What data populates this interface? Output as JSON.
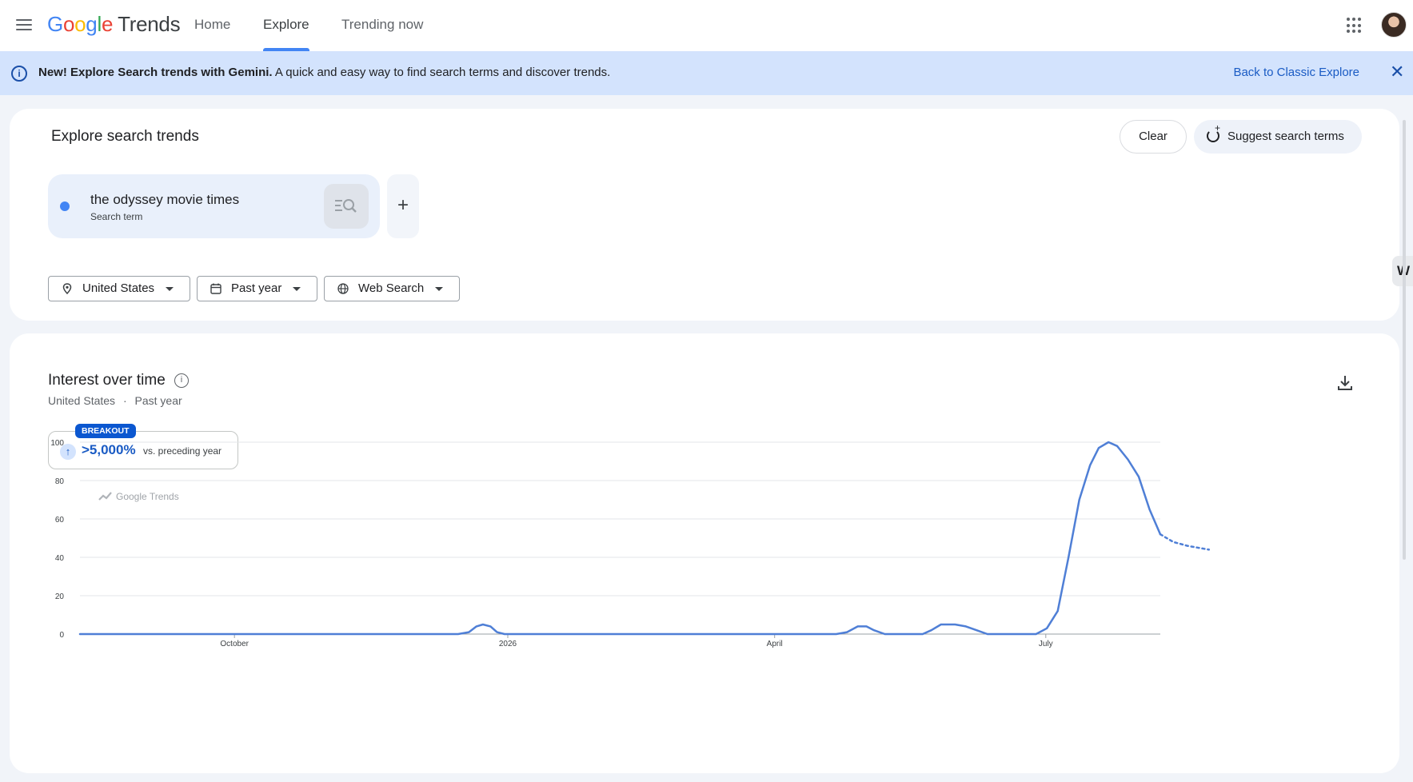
{
  "header": {
    "logo_google": "Google",
    "logo_trends": "Trends",
    "nav": [
      "Home",
      "Explore",
      "Trending now"
    ],
    "active_nav": "Explore"
  },
  "banner": {
    "bold": "New! Explore Search trends with Gemini.",
    "text": " A quick and easy way to find search terms and discover trends.",
    "classic_link": "Back to Classic Explore"
  },
  "explore": {
    "title": "Explore search trends",
    "clear_label": "Clear",
    "suggest_label": "Suggest search terms",
    "term": {
      "name": "the odyssey movie times",
      "type": "Search term",
      "dot_color": "#4285f4"
    },
    "filters": {
      "location": "United States",
      "time": "Past year",
      "property": "Web Search"
    },
    "side_tab_label": "W"
  },
  "interest": {
    "title": "Interest over time",
    "location": "United States",
    "separator": "·",
    "period": "Past year",
    "breakout_badge": "BREAKOUT",
    "breakout_value": ">5,000%",
    "breakout_note": "vs. preceding year",
    "watermark": "Google Trends"
  },
  "chart_data": {
    "type": "line",
    "title": "Interest over time",
    "xlabel": "",
    "ylabel": "",
    "ylim": [
      0,
      100
    ],
    "yticks": [
      0,
      20,
      40,
      60,
      80,
      100
    ],
    "x_tick_labels": [
      {
        "label": "October",
        "t": 0.143
      },
      {
        "label": "2026",
        "t": 0.396
      },
      {
        "label": "April",
        "t": 0.643
      },
      {
        "label": "July",
        "t": 0.894
      }
    ],
    "grid": true,
    "series": [
      {
        "color": "#4f7fd6",
        "points": [
          [
            0.0,
            0
          ],
          [
            0.35,
            0
          ],
          [
            0.36,
            1
          ],
          [
            0.367,
            4
          ],
          [
            0.373,
            5
          ],
          [
            0.38,
            4
          ],
          [
            0.386,
            1
          ],
          [
            0.393,
            0
          ],
          [
            0.7,
            0
          ],
          [
            0.71,
            1
          ],
          [
            0.72,
            4
          ],
          [
            0.728,
            4
          ],
          [
            0.735,
            2
          ],
          [
            0.745,
            0
          ],
          [
            0.78,
            0
          ],
          [
            0.788,
            2
          ],
          [
            0.797,
            5
          ],
          [
            0.81,
            5
          ],
          [
            0.82,
            4
          ],
          [
            0.83,
            2
          ],
          [
            0.84,
            0
          ],
          [
            0.885,
            0
          ],
          [
            0.895,
            3
          ],
          [
            0.905,
            12
          ],
          [
            0.915,
            40
          ],
          [
            0.925,
            70
          ],
          [
            0.935,
            88
          ],
          [
            0.943,
            97
          ],
          [
            0.952,
            100
          ],
          [
            0.96,
            98
          ],
          [
            0.97,
            91
          ],
          [
            0.98,
            82
          ],
          [
            0.99,
            65
          ],
          [
            1.0,
            52
          ]
        ],
        "partial_points": [
          [
            1.0,
            52
          ],
          [
            1.012,
            48
          ],
          [
            1.025,
            46
          ],
          [
            1.045,
            44
          ]
        ]
      }
    ]
  }
}
